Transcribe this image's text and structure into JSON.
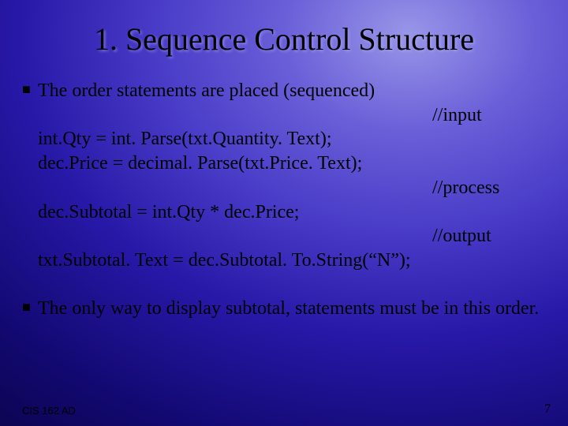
{
  "title": "1. Sequence Control Structure",
  "bullets": {
    "b1": "The order statements are placed (sequenced)",
    "b2": "The only way to display subtotal, statements must be in this order."
  },
  "comments": {
    "input": "//input",
    "process": "//process",
    "output": "//output"
  },
  "code": {
    "line1": "int.Qty = int. Parse(txt.Quantity. Text);",
    "line2": "dec.Price = decimal. Parse(txt.Price. Text);",
    "line3": "dec.Subtotal = int.Qty * dec.Price;",
    "line4": "txt.Subtotal. Text = dec.Subtotal. To.String(“N”);"
  },
  "footer": {
    "course": "CIS 162 AD",
    "page": "7"
  }
}
